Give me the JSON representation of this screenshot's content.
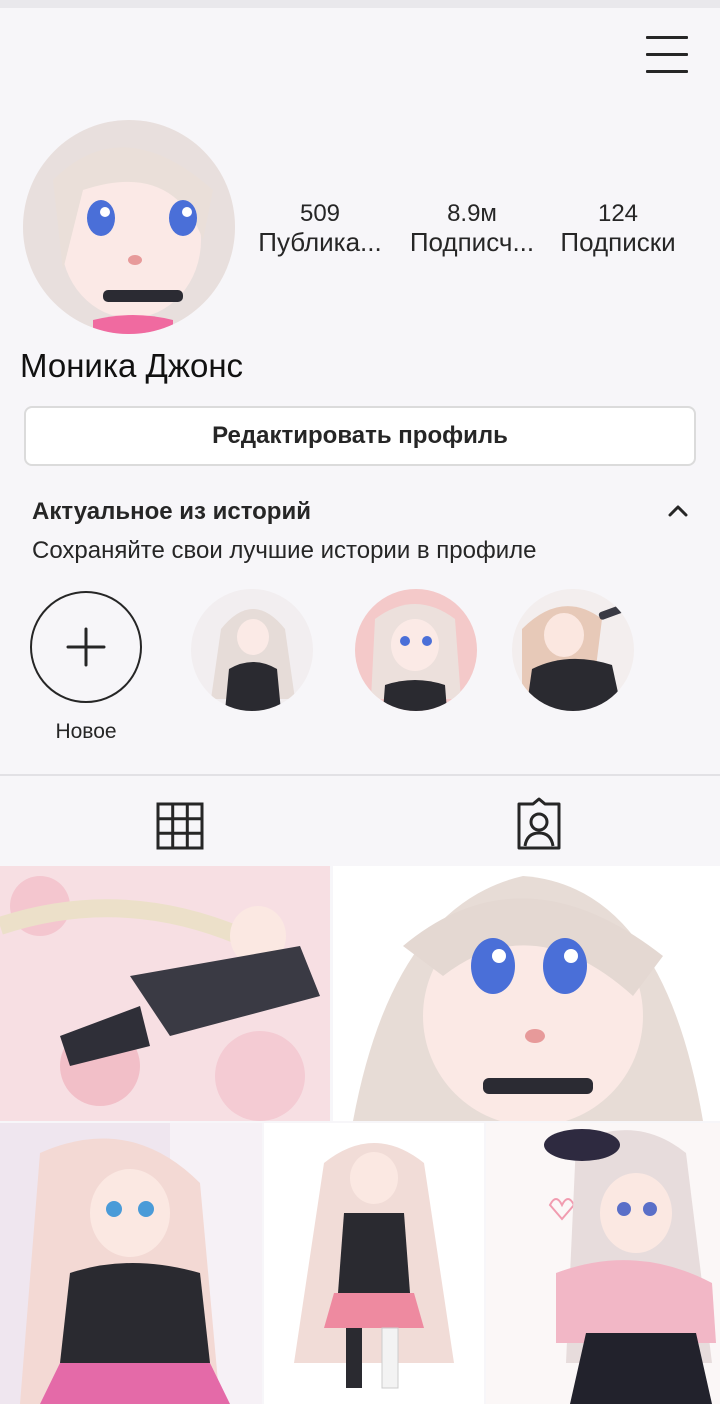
{
  "header": {
    "menu_icon": "hamburger-menu-icon"
  },
  "profile": {
    "name": "Моника Джонс",
    "stats": {
      "posts": {
        "value": "509",
        "label": "Публика..."
      },
      "followers": {
        "value": "8.9м",
        "label": "Подписч..."
      },
      "following": {
        "value": "124",
        "label": "Подписки"
      }
    },
    "edit_button_label": "Редактировать профиль"
  },
  "highlights": {
    "title": "Актуальное из историй",
    "subtitle": "Сохраняйте свои лучшие истории в профиле",
    "new_label": "Новое",
    "items": [
      {
        "name": "highlight-1",
        "bg": "#f2eef0"
      },
      {
        "name": "highlight-2",
        "bg": "#f4c9c9"
      },
      {
        "name": "highlight-3",
        "bg": "#f3eeee"
      }
    ]
  },
  "tabs": [
    {
      "name": "tab-grid",
      "icon": "grid-icon"
    },
    {
      "name": "tab-tagged",
      "icon": "tagged-person-icon"
    }
  ],
  "colors": {
    "background": "#f7f6f9",
    "text": "#262626",
    "border": "#dbdbdb"
  }
}
